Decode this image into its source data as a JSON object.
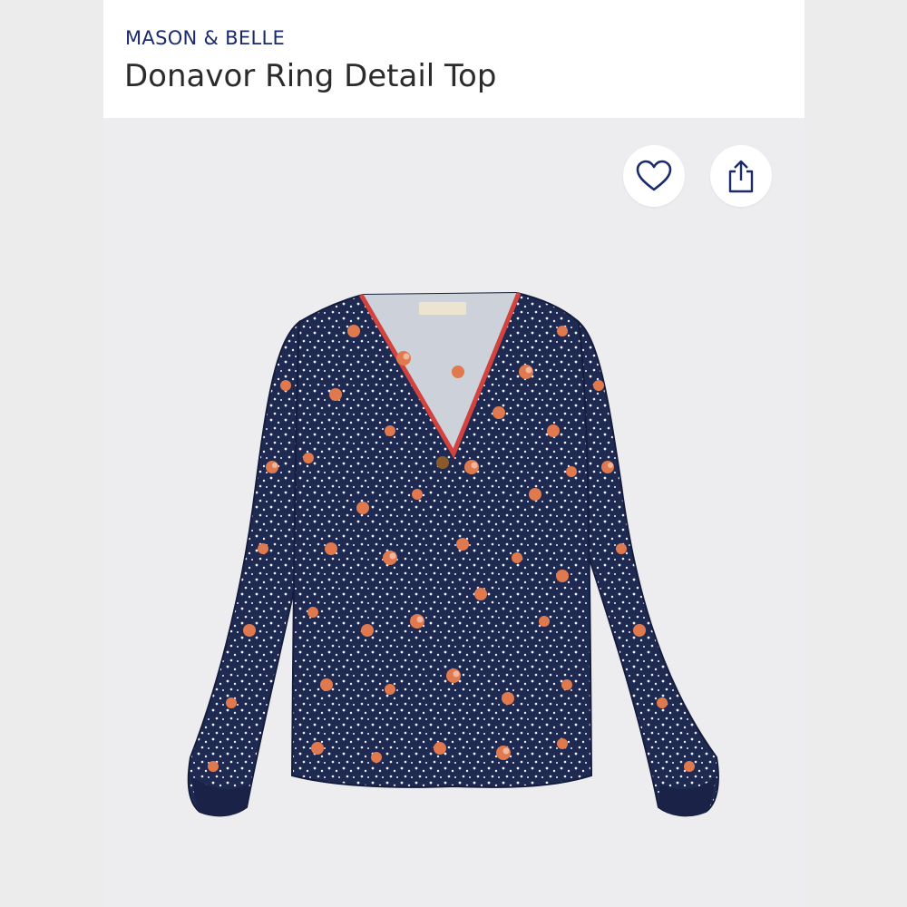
{
  "product": {
    "brand": "MASON & BELLE",
    "title": "Donavor Ring Detail Top"
  },
  "actions": {
    "favorite_icon": "heart-icon",
    "share_icon": "share-icon",
    "back_icon": "chevron-left-icon"
  },
  "colors": {
    "brand_text": "#1b2a6b",
    "fabric_navy": "#1f2a52",
    "flower_orange": "#e07a4e",
    "neckline_red": "#d2423e"
  }
}
